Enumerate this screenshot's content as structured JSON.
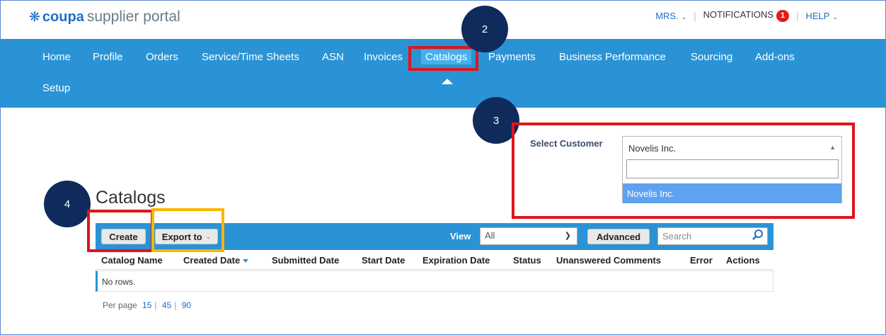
{
  "header": {
    "logo_brand": "coupa",
    "logo_rest": "supplier portal",
    "user_label": "MRS.",
    "notifications_label": "NOTIFICATIONS",
    "notifications_count": "1",
    "help_label": "HELP"
  },
  "nav": {
    "items": [
      "Home",
      "Profile",
      "Orders",
      "Service/Time Sheets",
      "ASN",
      "Invoices",
      "Catalogs",
      "Payments",
      "Business Performance",
      "Sourcing",
      "Add-ons",
      "Setup"
    ],
    "active": "Catalogs"
  },
  "callouts": [
    "2",
    "3",
    "4"
  ],
  "select_customer": {
    "label": "Select Customer",
    "value": "Novelis Inc.",
    "search_value": "",
    "options": [
      "Novelis Inc."
    ]
  },
  "catalogs": {
    "title": "Catalogs",
    "create_label": "Create",
    "export_label": "Export to",
    "view_label": "View",
    "view_value": "All",
    "advanced_label": "Advanced",
    "search_placeholder": "Search",
    "columns": [
      "Catalog Name",
      "Created Date",
      "Submitted Date",
      "Start Date",
      "Expiration Date",
      "Status",
      "Unanswered Comments",
      "Error",
      "Actions"
    ],
    "empty_text": "No rows.",
    "per_page_label": "Per page",
    "per_page_options": [
      "15",
      "45",
      "90"
    ]
  },
  "colors": {
    "nav_bg": "#2a93d5",
    "highlight_red": "#e0141c",
    "highlight_yellow": "#f5b800",
    "callout": "#0f2b5b"
  }
}
